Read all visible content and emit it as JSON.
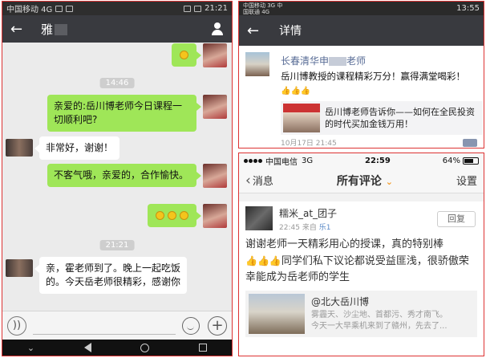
{
  "left": {
    "status": {
      "carrier": "中国移动 4G",
      "time": "21:21"
    },
    "header": {
      "back_icon": "←",
      "contact_name": "雅"
    },
    "messages": [
      {
        "side": "me",
        "kind": "emoji",
        "count": 1
      },
      {
        "side": "time",
        "text": "14:46"
      },
      {
        "side": "me",
        "text": "亲爱的:岳川博老师今日课程一切顺利吧?"
      },
      {
        "side": "them",
        "text": "非常好，谢谢！"
      },
      {
        "side": "me",
        "text": "不客气哦，亲爱的，合作愉快。"
      },
      {
        "side": "me",
        "kind": "emoji",
        "count": 3
      },
      {
        "side": "time",
        "text": "21:21"
      },
      {
        "side": "them",
        "text": "亲，霍老师到了。晚上一起吃饭的。今天岳老师很精彩，感谢你"
      }
    ],
    "bubble_color": "#9fe658"
  },
  "top_right": {
    "status": {
      "carrier": "中国移动 3G 中国联通 4G",
      "time": "13:55"
    },
    "title": "详情",
    "post": {
      "author": "长春清华申",
      "author_suffix": "老师",
      "text": "岳川博教授的课程精彩万分！赢得满堂喝彩！",
      "thumbs": "👍👍👍",
      "link_text": "岳川博老师告诉你——如何在全民投资的时代买加金钱万用！",
      "date": "10月17日 21:45"
    },
    "link_color": "#576b95"
  },
  "bottom_right": {
    "status": {
      "carrier": "中国电信",
      "network": "3G",
      "time": "22:59",
      "battery": "64%"
    },
    "header": {
      "back": "消息",
      "title": "所有评论",
      "settings": "设置"
    },
    "comment": {
      "user": "糯米_at_团子",
      "time": "22:45",
      "source_label": "来自",
      "source": "乐1",
      "reply_label": "回复",
      "text_1": "谢谢老师一天精彩用心的授课，真的特别棒",
      "text_2": "同学们私下议论都说受益匪浅，很骄傲荣幸能成为岳老师的学生",
      "ref_title": "@北大岳川博",
      "ref_line1": "雾霾天、沙尘地、首都污、秀才南飞。",
      "ref_line2": "今天一大早乘机来到了赣州，先去了..."
    },
    "accent_color": "#f59a23"
  }
}
